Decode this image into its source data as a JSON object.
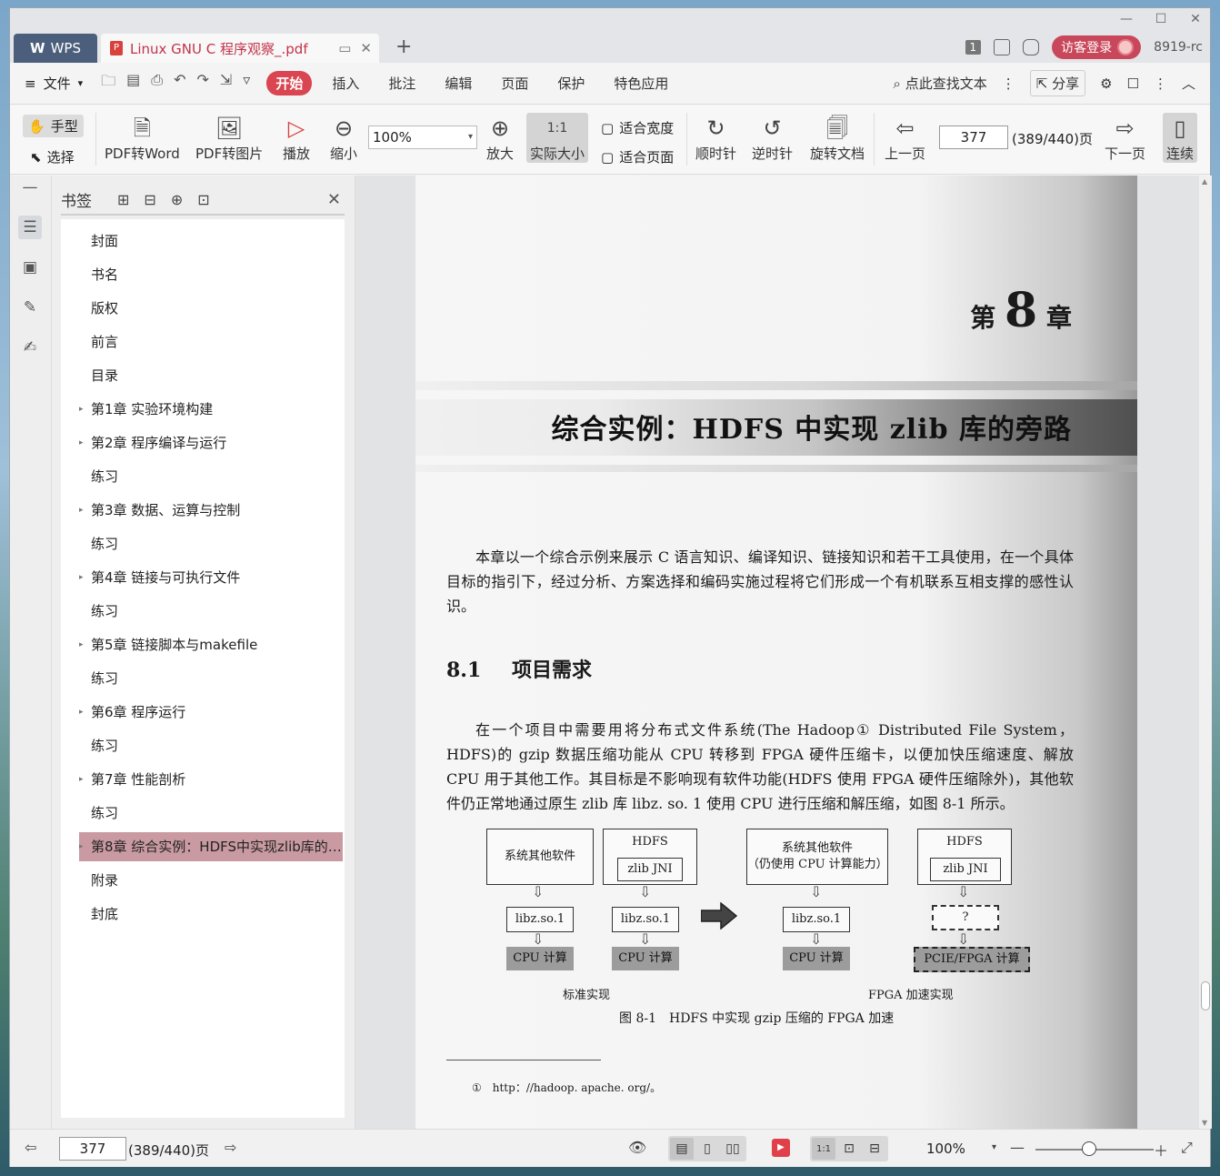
{
  "titlebar": {
    "wps_label": "WPS",
    "doc_tab": "Linux GNU C 程序观察_.pdf",
    "new_tab": "+",
    "badge": "1",
    "login": "访客登录",
    "user_id": "8919-rc",
    "window_controls": [
      "—",
      "☐",
      "✕"
    ]
  },
  "menubar": {
    "file": "文件",
    "items": [
      "开始",
      "插入",
      "批注",
      "编辑",
      "页面",
      "保护",
      "特色应用"
    ],
    "active": "开始",
    "search": "点此查找文本",
    "share": "分享"
  },
  "toolbar": {
    "hand": "手型",
    "select": "选择",
    "pdf_to_word": "PDF转Word",
    "pdf_to_image": "PDF转图片",
    "play": "播放",
    "zoom_out": "缩小",
    "zoom_value": "100%",
    "zoom_in": "放大",
    "actual_size": "实际大小",
    "fit_width": "适合宽度",
    "fit_page": "适合页面",
    "rotate_cw": "顺时针",
    "rotate_ccw": "逆时针",
    "rotate_doc": "旋转文档",
    "prev_page": "上一页",
    "page_input": "377",
    "page_total": "(389/440)页",
    "next_page": "下一页",
    "continuous": "连续"
  },
  "bookmarks": {
    "title": "书签",
    "items": [
      {
        "label": "封面",
        "expandable": false
      },
      {
        "label": "书名",
        "expandable": false
      },
      {
        "label": "版权",
        "expandable": false
      },
      {
        "label": "前言",
        "expandable": false
      },
      {
        "label": "目录",
        "expandable": false
      },
      {
        "label": "第1章 实验环境构建",
        "expandable": true
      },
      {
        "label": "第2章 程序编译与运行",
        "expandable": true
      },
      {
        "label": "练习",
        "expandable": false
      },
      {
        "label": "第3章 数据、运算与控制",
        "expandable": true
      },
      {
        "label": "练习",
        "expandable": false
      },
      {
        "label": "第4章 链接与可执行文件",
        "expandable": true
      },
      {
        "label": "练习",
        "expandable": false
      },
      {
        "label": "第5章 链接脚本与makefile",
        "expandable": true
      },
      {
        "label": "练习",
        "expandable": false
      },
      {
        "label": "第6章 程序运行",
        "expandable": true
      },
      {
        "label": "练习",
        "expandable": false
      },
      {
        "label": "第7章 性能剖析",
        "expandable": true
      },
      {
        "label": "练习",
        "expandable": false
      },
      {
        "label": "第8章 综合实例：HDFS中实现zlib库的旁路",
        "expandable": true,
        "selected": true
      },
      {
        "label": "附录",
        "expandable": false
      },
      {
        "label": "封底",
        "expandable": false
      }
    ]
  },
  "page": {
    "chapter_prefix": "第",
    "chapter_number": "8",
    "chapter_suffix": "章",
    "chapter_title": "综合实例：HDFS 中实现 zlib 库的旁路",
    "intro": "本章以一个综合示例来展示 C 语言知识、编译知识、链接知识和若干工具使用，在一个具体目标的指引下，经过分析、方案选择和编码实施过程将它们形成一个有机联系互相支撑的感性认识。",
    "section_number": "8.1",
    "section_title": "项目需求",
    "body": "在一个项目中需要用将分布式文件系统(The Hadoop① Distributed File System，HDFS)的 gzip 数据压缩功能从 CPU 转移到 FPGA 硬件压缩卡，以便加快压缩速度、解放 CPU 用于其他工作。其目标是不影响现有软件功能(HDFS 使用 FPGA 硬件压缩除外)，其他软件仍正常地通过原生 zlib 库 libz. so. 1 使用 CPU 进行压缩和解压缩，如图 8-1 所示。",
    "figure": {
      "left": {
        "other_sw": "系统其他软件",
        "hdfs": "HDFS",
        "zlib_jni": "zlib JNI",
        "libz_a": "libz.so.1",
        "libz_b": "libz.so.1",
        "cpu_a": "CPU 计算",
        "cpu_b": "CPU 计算",
        "caption": "标准实现"
      },
      "right": {
        "other_sw_line1": "系统其他软件",
        "other_sw_line2": "（仍使用 CPU 计算能力）",
        "hdfs": "HDFS",
        "zlib_jni": "zlib JNI",
        "libz": "libz.so.1",
        "unknown": "?",
        "cpu": "CPU 计算",
        "fpga": "PCIE/FPGA 计算",
        "caption": "FPGA 加速实现"
      },
      "title": "图 8-1　HDFS 中实现 gzip 压缩的 FPGA 加速"
    },
    "footnote": "①　http：//hadoop. apache. org/。"
  },
  "statusbar": {
    "page_input": "377",
    "page_total": "(389/440)页",
    "zoom": "100%",
    "zoom_fraction": 0.45
  }
}
